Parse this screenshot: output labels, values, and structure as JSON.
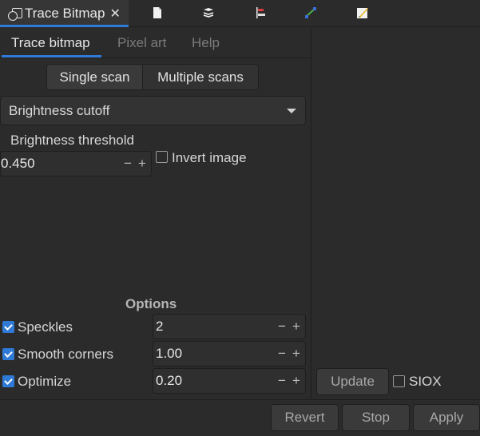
{
  "dock": {
    "active_tab_label": "Trace Bitmap",
    "close_glyph": "✕",
    "other_tab_icons": [
      "document-properties-icon",
      "layers-icon",
      "align-distribute-icon",
      "node-editor-icon",
      "paint-edit-icon"
    ]
  },
  "tabs": [
    {
      "label": "Trace bitmap",
      "active": true
    },
    {
      "label": "Pixel art",
      "active": false
    },
    {
      "label": "Help",
      "active": false
    }
  ],
  "scan_mode": {
    "single_label": "Single scan",
    "multiple_label": "Multiple scans",
    "selected": "Single scan"
  },
  "detection_mode": {
    "selected": "Brightness cutoff"
  },
  "threshold": {
    "label": "Brightness threshold",
    "value": "0.450",
    "minus": "−",
    "plus": "+"
  },
  "invert": {
    "label": "Invert image",
    "checked": false
  },
  "options": {
    "heading": "Options",
    "items": [
      {
        "label": "Speckles",
        "checked": true,
        "value": "2",
        "minus": "−",
        "plus": "+"
      },
      {
        "label": "Smooth corners",
        "checked": true,
        "value": "1.00",
        "minus": "−",
        "plus": "+"
      },
      {
        "label": "Optimize",
        "checked": true,
        "value": "0.20",
        "minus": "−",
        "plus": "+"
      }
    ]
  },
  "preview": {
    "update_label": "Update",
    "siox_label": "SIOX",
    "siox_checked": false
  },
  "actions": {
    "revert_label": "Revert",
    "stop_label": "Stop",
    "apply_label": "Apply"
  },
  "colors": {
    "accent": "#2f7ad6",
    "background": "#2b2b2b",
    "text": "#dcdcdc"
  }
}
